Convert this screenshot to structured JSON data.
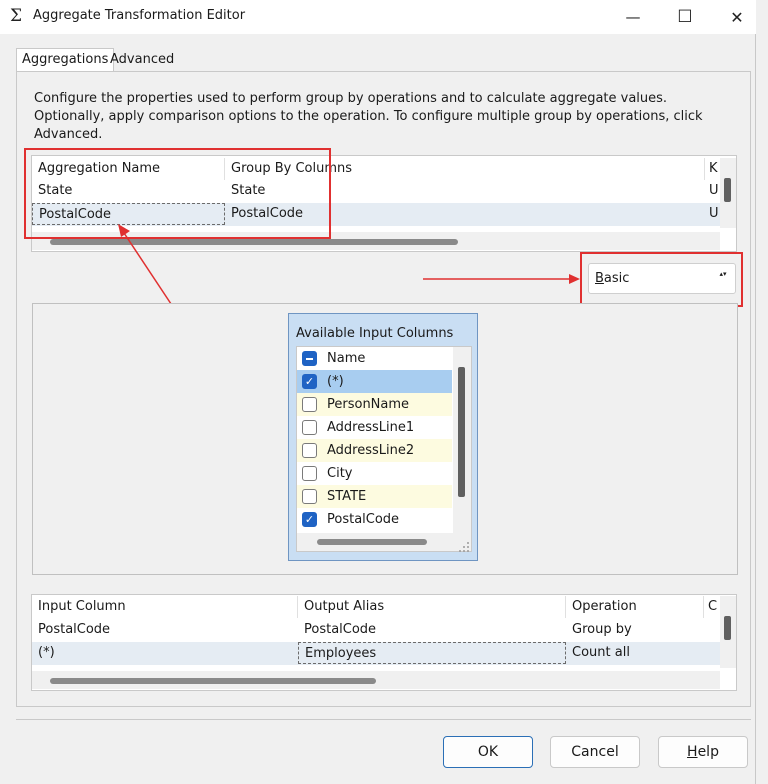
{
  "window": {
    "icon_glyph": "Σ",
    "title": "Aggregate Transformation Editor",
    "minimize_glyph": "—",
    "maximize_glyph": "☐",
    "close_glyph": "✕"
  },
  "tabs": [
    {
      "label": "Aggregations",
      "active": true
    },
    {
      "label": "Advanced",
      "active": false
    }
  ],
  "description": "Configure the properties used to perform group by operations and to calculate aggregate values. Optionally, apply comparison options to the operation. To configure multiple group by operations, click Advanced.",
  "aggregations_grid": {
    "columns": [
      "Aggregation Name",
      "Group By Columns",
      "K"
    ],
    "rows": [
      [
        "State",
        "State",
        "U"
      ],
      [
        "PostalCode",
        "PostalCode",
        "U"
      ]
    ]
  },
  "mode_combo": {
    "mnemonic": "B",
    "rest": "asic",
    "arrow_glyph": "▴▾"
  },
  "available_input_columns": {
    "title": "Available Input Columns",
    "header": {
      "label": "Name"
    },
    "items": [
      {
        "label": "(*)",
        "checked": true
      },
      {
        "label": "PersonName",
        "checked": false
      },
      {
        "label": "AddressLine1",
        "checked": false
      },
      {
        "label": "AddressLine2",
        "checked": false
      },
      {
        "label": "City",
        "checked": false
      },
      {
        "label": "STATE",
        "checked": false
      },
      {
        "label": "PostalCode",
        "checked": true
      }
    ]
  },
  "columns_grid": {
    "columns": [
      "Input Column",
      "Output Alias",
      "Operation",
      "C"
    ],
    "rows": [
      [
        "PostalCode",
        "PostalCode",
        "Group by",
        ""
      ],
      [
        "(*)",
        "Employees",
        "Count all",
        ""
      ]
    ]
  },
  "buttons": {
    "ok": "OK",
    "cancel": "Cancel",
    "help_mnemonic": "H",
    "help_rest": "elp"
  },
  "colors": {
    "annotation_red": "#e03030",
    "selection_blue": "#a8cdf0",
    "highlight_yellow": "#fdfbe0",
    "checkbox_blue": "#1f63c4"
  },
  "icons": [
    "sigma-icon",
    "minimize-icon",
    "maximize-icon",
    "close-icon",
    "checkmark-icon",
    "combo-arrow-icon",
    "resize-grip-icon",
    "annotation-arrow-icon"
  ]
}
